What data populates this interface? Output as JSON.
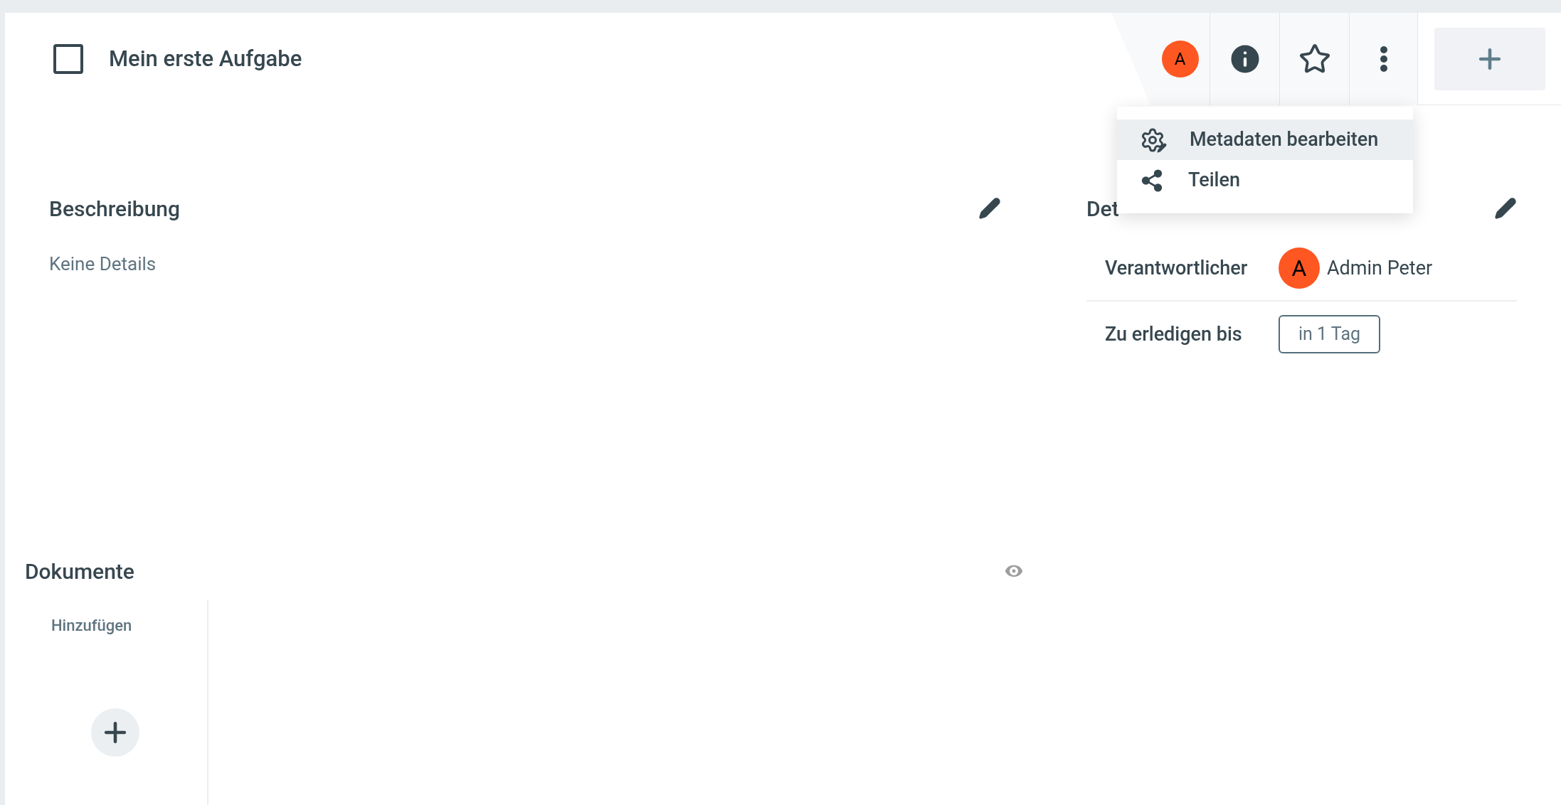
{
  "task": {
    "title": "Mein erste Aufgabe",
    "checked": false
  },
  "toolbar": {
    "avatar": "A"
  },
  "menu": [
    {
      "label": "Metadaten bearbeiten",
      "kind": "edit-metadata",
      "selected": true
    },
    {
      "label": "Teilen",
      "kind": "share",
      "selected": false
    }
  ],
  "description": {
    "heading": "Beschreibung",
    "text": "Keine Details"
  },
  "details": {
    "heading": "Det",
    "rows": [
      {
        "label": "Verantwortlicher",
        "kind": "person",
        "avatar": "A",
        "value": "Admin Peter"
      },
      {
        "label": "Zu erledigen bis",
        "kind": "chip",
        "value": "in 1 Tag"
      }
    ]
  },
  "documents": {
    "heading": "Dokumente",
    "add_label": "Hinzufügen"
  }
}
